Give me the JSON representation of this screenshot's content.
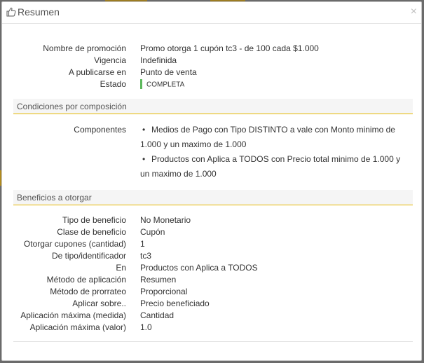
{
  "modal": {
    "title": "Resumen",
    "close_glyph": "×",
    "header_icon": "thumbs-up-icon"
  },
  "summary": {
    "rows": [
      {
        "label": "Nombre de promoción",
        "value": "Promo otorga 1 cupón tc3 - de 100 cada $1.000"
      },
      {
        "label": "Vigencia",
        "value": "Indefinida"
      },
      {
        "label": "A publicarse en",
        "value": "Punto de venta"
      },
      {
        "label": "Estado",
        "value": "COMPLETA"
      }
    ],
    "status_color": "#5cb85c"
  },
  "conditions": {
    "title": "Condiciones por composición",
    "label": "Componentes",
    "items": [
      "Medios de Pago con Tipo DISTINTO a vale con Monto minimo de 1.000 y un maximo de 1.000",
      "Productos con Aplica a TODOS con Precio total minimo de 1.000 y un maximo de 1.000"
    ]
  },
  "benefits": {
    "title": "Beneficios a otorgar",
    "rows": [
      {
        "label": "Tipo de beneficio",
        "value": "No Monetario"
      },
      {
        "label": "Clase de beneficio",
        "value": "Cupón"
      },
      {
        "label": "Otorgar cupones (cantidad)",
        "value": "1"
      },
      {
        "label": "De tipo/identificador",
        "value": "tc3"
      },
      {
        "label": "En",
        "value": "Productos con Aplica a TODOS"
      },
      {
        "label": "Método de aplicación",
        "value": "Resumen"
      },
      {
        "label": "Método de prorrateo",
        "value": "Proporcional"
      },
      {
        "label": "Aplicar sobre..",
        "value": "Precio beneficiado"
      },
      {
        "label": "Aplicación máxima (medida)",
        "value": "Cantidad"
      },
      {
        "label": "Aplicación máxima (valor)",
        "value": "1.0"
      }
    ]
  },
  "colors": {
    "accent": "#e6b800",
    "section_bg": "#f5f5f5"
  }
}
